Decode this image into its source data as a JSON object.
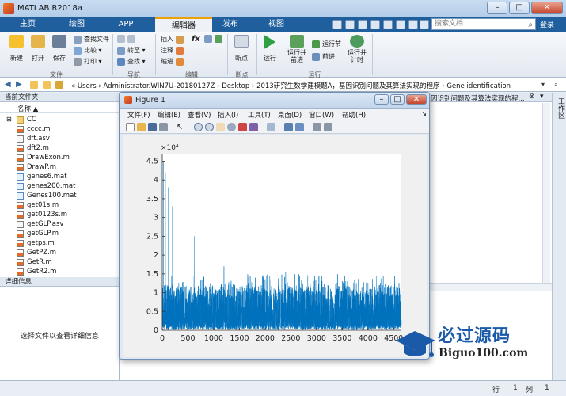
{
  "app": {
    "title": "MATLAB R2018a",
    "brand_color": "#1f5f9e"
  },
  "tabs": [
    "主页",
    "绘图",
    "APP",
    "编辑器",
    "发布",
    "视图"
  ],
  "active_tab": "编辑器",
  "search": {
    "placeholder": "搜索文档"
  },
  "login": "登录",
  "ribbon": {
    "file_group": {
      "label": "文件",
      "new": "新建",
      "open": "打开",
      "save": "保存",
      "find_files": "查找文件",
      "compare": "比较",
      "print": "打印"
    },
    "nav_group": {
      "label": "导航",
      "goto": "转至",
      "find": "查找"
    },
    "edit_group": {
      "label": "编辑",
      "insert": "插入",
      "comment": "注释",
      "indent": "缩进",
      "fx": "fx"
    },
    "breakpoint_group": {
      "label": "断点",
      "breakpoints": "断点"
    },
    "run_group": {
      "label": "运行",
      "run": "运行",
      "run_advance": "运行并\n前进",
      "run_section": "运行节",
      "advance": "前进",
      "run_time": "运行并\n计时"
    }
  },
  "address": {
    "path": "« Users › Administrator.WIN7U-20180127Z › Desktop › 2013研究生数学建模题A，基因识别问题及其算法实现的程序 › Gene identification"
  },
  "current_folder": {
    "header": "当前文件夹",
    "column": "名称 ▲",
    "files": [
      {
        "name": "CC",
        "type": "dir"
      },
      {
        "name": "cccc.m",
        "type": "m"
      },
      {
        "name": "dft.asv",
        "type": "asv"
      },
      {
        "name": "dft2.m",
        "type": "m"
      },
      {
        "name": "DrawExon.m",
        "type": "m"
      },
      {
        "name": "DrawP.m",
        "type": "m"
      },
      {
        "name": "genes6.mat",
        "type": "mat"
      },
      {
        "name": "genes200.mat",
        "type": "mat"
      },
      {
        "name": "Genes100.mat",
        "type": "mat"
      },
      {
        "name": "get01s.m",
        "type": "m"
      },
      {
        "name": "get0123s.m",
        "type": "m"
      },
      {
        "name": "getGLP.asv",
        "type": "asv"
      },
      {
        "name": "getGLP.m",
        "type": "m"
      },
      {
        "name": "getps.m",
        "type": "m"
      },
      {
        "name": "GetPZ.m",
        "type": "m"
      },
      {
        "name": "GetR.m",
        "type": "m"
      },
      {
        "name": "GetR2.m",
        "type": "m"
      }
    ]
  },
  "details": {
    "header": "详细信息",
    "empty_text": "选择文件以查看详细信息"
  },
  "editor_tab_title": "因识别问题及其算法实现的程...",
  "workspace_label": "工作区",
  "status": {
    "line_label": "行",
    "line": "1",
    "col_label": "列",
    "col": "1"
  },
  "figure": {
    "title": "Figure 1",
    "menu": [
      "文件(F)",
      "编辑(E)",
      "查看(V)",
      "插入(I)",
      "工具(T)",
      "桌面(D)",
      "窗口(W)",
      "帮助(H)"
    ]
  },
  "chart_data": {
    "type": "line",
    "series_color": "#0072bd",
    "xlim": [
      0,
      4650
    ],
    "ylim": [
      0,
      47000
    ],
    "x_ticks": [
      "0",
      "500",
      "1000",
      "1500",
      "2000",
      "2500",
      "3000",
      "3500",
      "4000",
      "4500"
    ],
    "y_ticks": [
      "0",
      "0.5",
      "1",
      "1.5",
      "2",
      "2.5",
      "3",
      "3.5",
      "4",
      "4.5"
    ],
    "y_exponent": "×10⁴",
    "n_points": 4650,
    "typical_range": [
      0,
      15000
    ],
    "spikes": [
      {
        "x": 20,
        "y": 45000
      },
      {
        "x": 60,
        "y": 42000
      },
      {
        "x": 120,
        "y": 38000
      },
      {
        "x": 200,
        "y": 33000
      },
      {
        "x": 620,
        "y": 25000
      },
      {
        "x": 1200,
        "y": 17000
      },
      {
        "x": 2400,
        "y": 15500
      },
      {
        "x": 3550,
        "y": 14500
      },
      {
        "x": 4640,
        "y": 19000
      }
    ]
  },
  "watermark": {
    "text": "必过源码",
    "url": "Biguo100.com"
  }
}
